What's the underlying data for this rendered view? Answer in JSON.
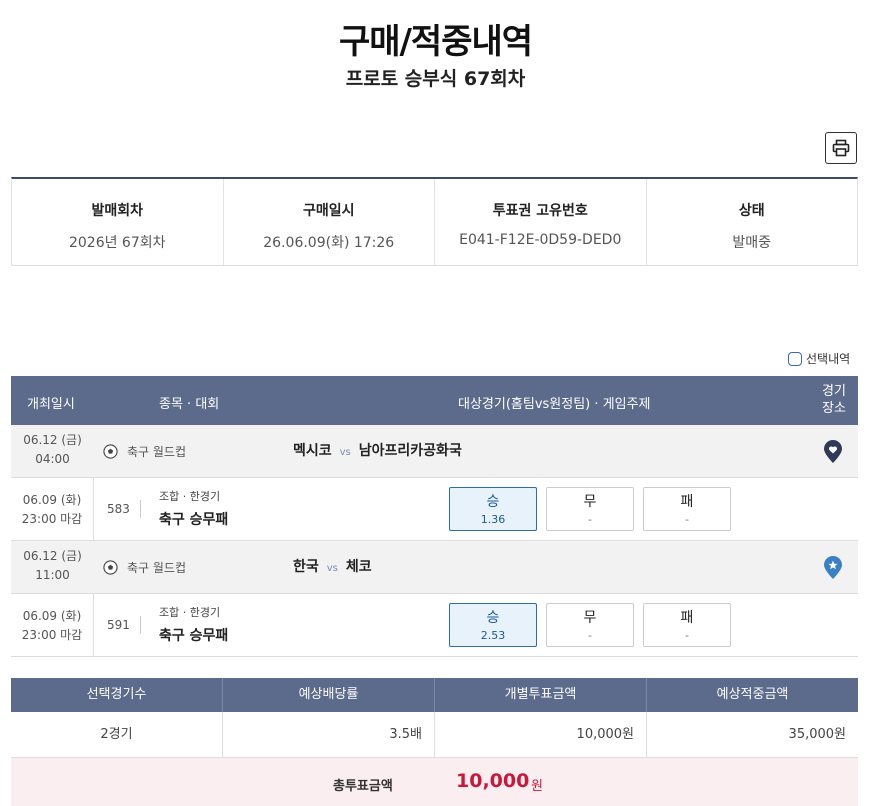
{
  "page": {
    "title": "구매/적중내역",
    "subtitle": "프로토 승부식 67회차"
  },
  "info": {
    "headers": [
      "발매회차",
      "구매일시",
      "투표권 고유번호",
      "상태"
    ],
    "values": [
      "2026년 67회차",
      "26.06.09(화) 17:26",
      "E041-F12E-0D59-DED0",
      "발매중"
    ]
  },
  "select_toggle": {
    "label": "선택내역"
  },
  "match_table": {
    "headers": {
      "date": "개최일시",
      "sport": "종목 · 대회",
      "match": "대상경기(홈팀vs원정팀) · 게임주제",
      "venue_line1": "경기",
      "venue_line2": "장소"
    },
    "games": [
      {
        "date": "06.12 (금)",
        "time": "04:00",
        "sport": "축구 월드컵",
        "home": "멕시코",
        "vs": "vs",
        "away": "남아프리카공화국",
        "venue_icon": "heart-marker-icon",
        "bet": {
          "date": "06.09 (화)",
          "time": "23:00 마감",
          "number": "583",
          "sub": "조합 · 한경기",
          "main": "축구 승무패",
          "odds": [
            {
              "label": "승",
              "value": "1.36",
              "selected": true
            },
            {
              "label": "무",
              "value": "-",
              "selected": false
            },
            {
              "label": "패",
              "value": "-",
              "selected": false
            }
          ]
        }
      },
      {
        "date": "06.12 (금)",
        "time": "11:00",
        "sport": "축구 월드컵",
        "home": "한국",
        "vs": "vs",
        "away": "체코",
        "venue_icon": "star-marker-icon",
        "bet": {
          "date": "06.09 (화)",
          "time": "23:00 마감",
          "number": "591",
          "sub": "조합 · 한경기",
          "main": "축구 승무패",
          "odds": [
            {
              "label": "승",
              "value": "2.53",
              "selected": true
            },
            {
              "label": "무",
              "value": "-",
              "selected": false
            },
            {
              "label": "패",
              "value": "-",
              "selected": false
            }
          ]
        }
      }
    ]
  },
  "summary": {
    "headers": [
      "선택경기수",
      "예상배당률",
      "개별투표금액",
      "예상적중금액"
    ],
    "values": [
      "2경기",
      "3.5배",
      "10,000원",
      "35,000원"
    ]
  },
  "total": {
    "label": "총투표금액",
    "value": "10,000",
    "unit": "원"
  },
  "colors": {
    "header_bg": "#5c6a8c",
    "selected_odd_bg": "#e7f2fb",
    "total_value": "#c8193c",
    "marker_dark": "#2f3a57",
    "marker_blue": "#3b7fc4"
  }
}
